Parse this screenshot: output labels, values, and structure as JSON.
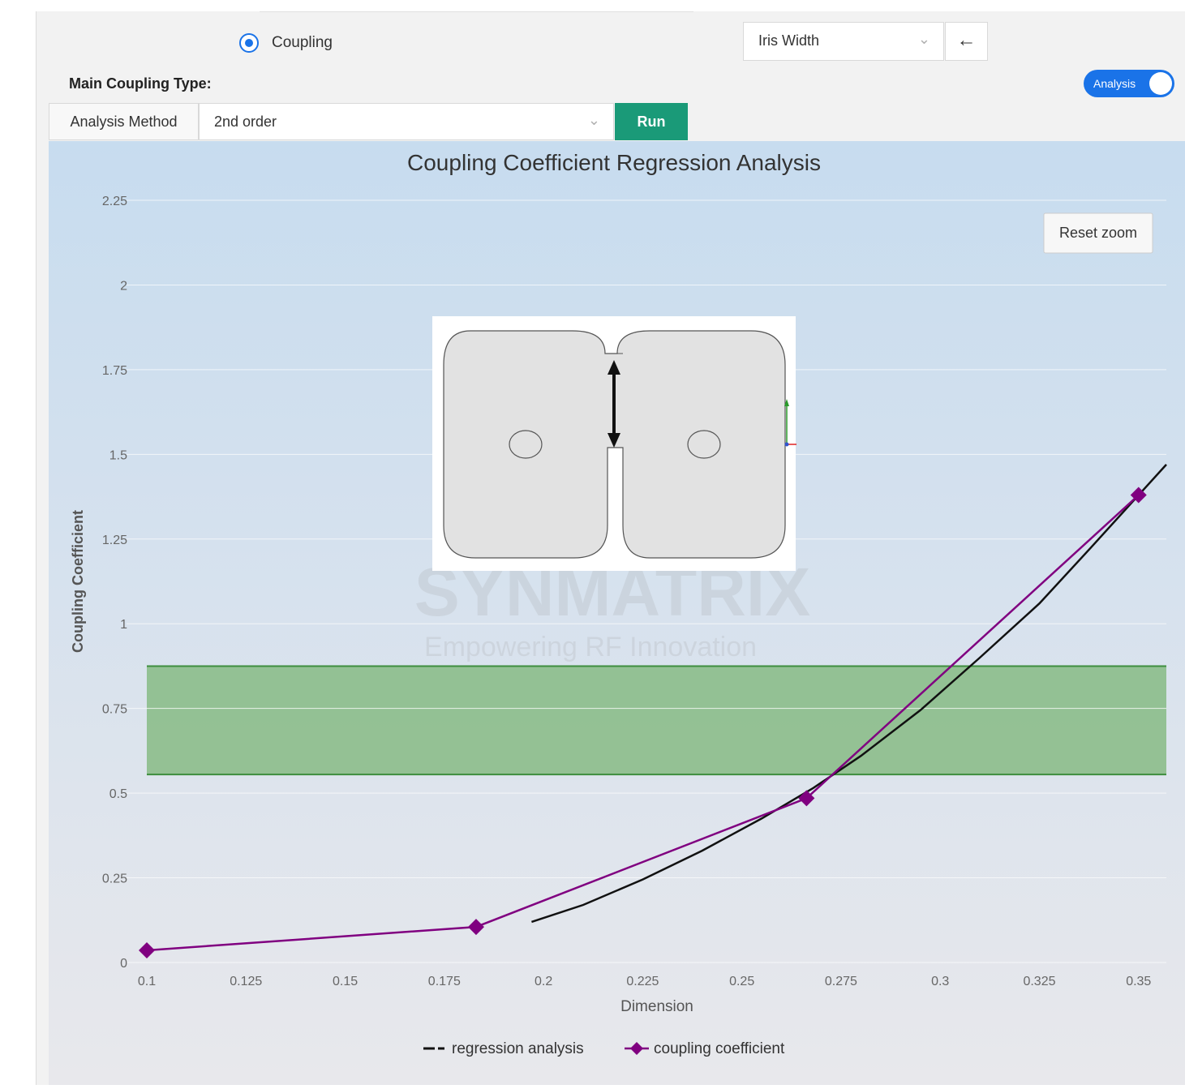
{
  "controls": {
    "radio_label": "Coupling",
    "dimension_select": "Iris Width",
    "back_icon": "arrow-left-icon",
    "main_coupling_label": "Main Coupling Type:",
    "toggle_label": "Analysis",
    "toggle_on": true,
    "analysis_method_label": "Analysis Method",
    "analysis_method_value": "2nd order",
    "run_label": "Run",
    "reset_zoom_label": "Reset zoom"
  },
  "watermark": {
    "main": "SYNMATRIX",
    "sub": "Empowering RF Innovation"
  },
  "chart_data": {
    "type": "line",
    "title": "Coupling Coefficient Regression Analysis",
    "xlabel": "Dimension",
    "ylabel": "Coupling Coefficient",
    "xlim": [
      0.1,
      0.357
    ],
    "ylim": [
      0,
      2.25
    ],
    "x_ticks": [
      "0.1",
      "0.125",
      "0.15",
      "0.175",
      "0.2",
      "0.225",
      "0.25",
      "0.275",
      "0.3",
      "0.325",
      "0.35"
    ],
    "y_ticks": [
      "0",
      "0.25",
      "0.5",
      "0.75",
      "1",
      "1.25",
      "1.5",
      "1.75",
      "2",
      "2.25"
    ],
    "band": {
      "y_from": 0.555,
      "y_to": 0.875,
      "color": "#8fbf8f"
    },
    "series": [
      {
        "name": "regression analysis",
        "color": "#111111",
        "style": "dashed-line",
        "x": [
          0.197,
          0.21,
          0.225,
          0.24,
          0.255,
          0.268,
          0.28,
          0.295,
          0.31,
          0.325,
          0.338,
          0.357
        ],
        "y": [
          0.12,
          0.17,
          0.245,
          0.33,
          0.425,
          0.515,
          0.61,
          0.745,
          0.9,
          1.06,
          1.225,
          1.47
        ]
      },
      {
        "name": "coupling coefficient",
        "color": "#800080",
        "style": "line-diamond",
        "x": [
          0.1,
          0.183,
          0.2663,
          0.35
        ],
        "y": [
          0.036,
          0.105,
          0.485,
          1.38
        ]
      }
    ],
    "legend_position": "bottom-center",
    "grid": true
  }
}
